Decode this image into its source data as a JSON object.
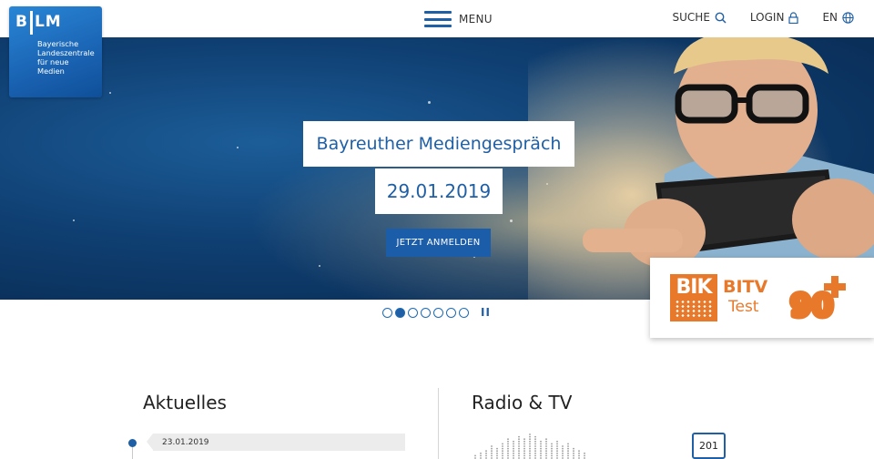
{
  "header": {
    "menu_label": "MENU",
    "search_label": "SUCHE",
    "login_label": "LOGIN",
    "language_label": "EN"
  },
  "logo": {
    "mark": "BLM",
    "line1": "Bayerische",
    "line2": "Landeszentrale",
    "line3": "für neue Medien"
  },
  "hero": {
    "title": "Bayreuther Mediengespräch",
    "date": "29.01.2019",
    "cta_label": "JETZT ANMELDEN",
    "slides_total": 7,
    "slide_active": 2,
    "pause_label": "II"
  },
  "badge": {
    "bik": "BIK",
    "bitv": "BITV",
    "test": "Test",
    "score": "90"
  },
  "news": {
    "heading": "Aktuelles",
    "first_date": "23.01.2019"
  },
  "media": {
    "heading": "Radio & TV",
    "channel": "201"
  },
  "colors": {
    "brand_blue": "#1f5fa5",
    "badge_orange": "#e8792b"
  }
}
